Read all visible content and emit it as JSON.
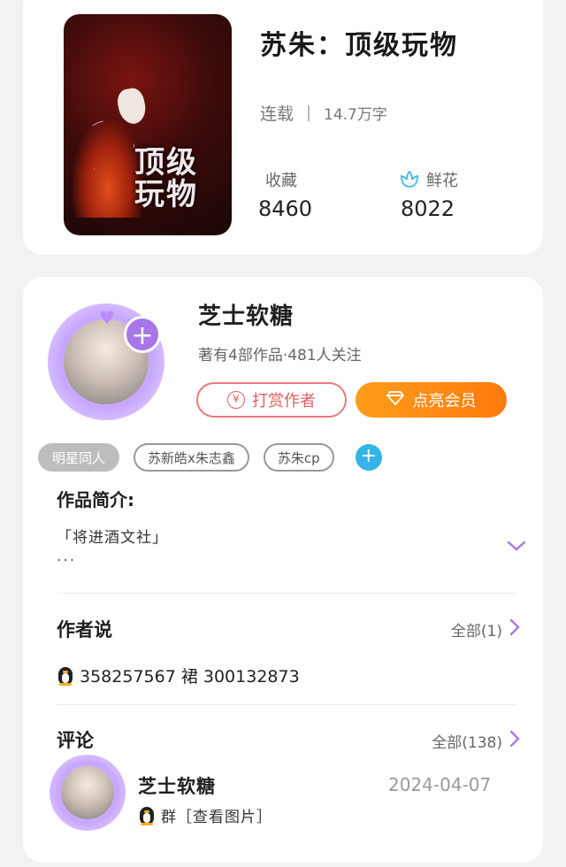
{
  "book": {
    "title": "苏朱：顶级玩物",
    "status": "连载",
    "word_count": "14.7万字",
    "cover_text": "顶级玩物",
    "collect_label": "收藏",
    "collect_value": "8460",
    "flower_label": "鲜花",
    "flower_value": "8022"
  },
  "author": {
    "name": "芝士软糖",
    "stats": "著有4部作品·481人关注",
    "tip_button": "打赏作者",
    "tip_icon_glyph": "¥",
    "vip_button": "点亮会员",
    "follow_glyph": "+"
  },
  "tags": [
    "明星同人",
    "苏新皓x朱志鑫",
    "苏朱cp"
  ],
  "tag_add_glyph": "+",
  "intro": {
    "title": "作品简介:",
    "line1": "「将进酒文社」",
    "line2": "..."
  },
  "author_says": {
    "title": "作者说",
    "see_all": "全部(1)",
    "text": "358257567 裙 300132873"
  },
  "comments": {
    "title": "评论",
    "see_all": "全部(138)",
    "items": [
      {
        "name": "芝士软糖",
        "date": "2024-04-07",
        "text": "群［查看图片］"
      }
    ]
  },
  "colors": {
    "accent_purple": "#a777e8",
    "tip_red": "#e25f5f",
    "vip_orange": "#ff8a12",
    "tag_add_blue": "#33b4ea",
    "flower_blue": "#3fb7e6"
  },
  "icons": [
    "penguin-icon",
    "flower-icon",
    "chevron-down-icon",
    "chevron-right-icon",
    "diamond-icon",
    "yen-icon",
    "plus-icon"
  ]
}
